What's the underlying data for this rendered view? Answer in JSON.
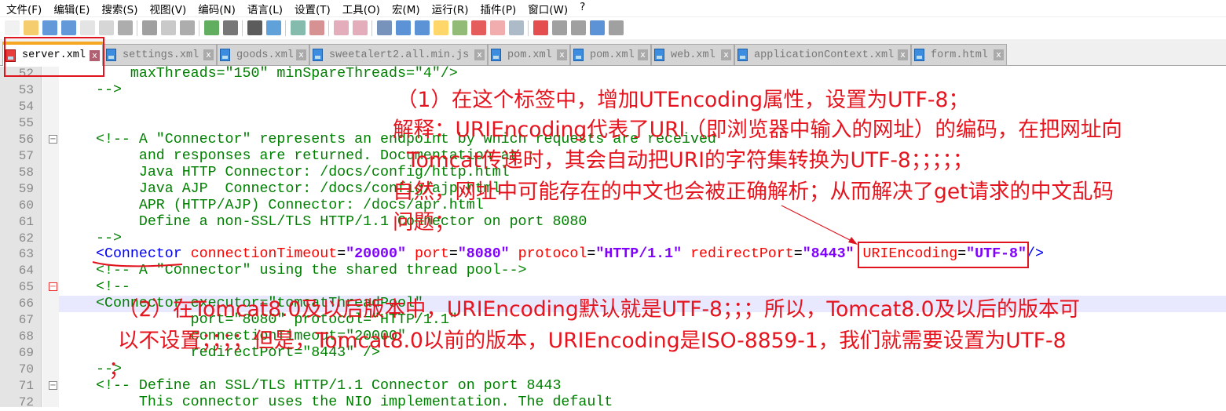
{
  "menu": [
    "文件(F)",
    "编辑(E)",
    "搜索(S)",
    "视图(V)",
    "编码(N)",
    "语言(L)",
    "设置(T)",
    "工具(O)",
    "宏(M)",
    "运行(R)",
    "插件(P)",
    "窗口(W)",
    "?"
  ],
  "tabs": [
    {
      "label": "server.xml",
      "active": true
    },
    {
      "label": "settings.xml"
    },
    {
      "label": "goods.xml"
    },
    {
      "label": "sweetalert2.all.min.js"
    },
    {
      "label": "pom.xml"
    },
    {
      "label": "pom.xml"
    },
    {
      "label": "web.xml"
    },
    {
      "label": "applicationContext.xml"
    },
    {
      "label": "form.html"
    }
  ],
  "close_glyph": "x",
  "lines": [
    {
      "n": "52",
      "fold": "",
      "html": "    maxThreads=\"150\" minSpareThreads=\"4\"/>"
    },
    {
      "n": "53",
      "fold": "",
      "html": "-->"
    },
    {
      "n": "54",
      "fold": "",
      "html": ""
    },
    {
      "n": "55",
      "fold": "",
      "html": ""
    },
    {
      "n": "56",
      "fold": "box",
      "html": "<!-- A \"Connector\" represents an endpoint by which requests are received"
    },
    {
      "n": "57",
      "fold": "",
      "html": "     and responses are returned. Documentation at :"
    },
    {
      "n": "58",
      "fold": "",
      "html": "     Java HTTP Connector: /docs/config/http.html"
    },
    {
      "n": "59",
      "fold": "",
      "html": "     Java AJP  Connector: /docs/config/ajp.html"
    },
    {
      "n": "60",
      "fold": "",
      "html": "     APR (HTTP/AJP) Connector: /docs/apr.html"
    },
    {
      "n": "61",
      "fold": "",
      "html": "     Define a non-SSL/TLS HTTP/1.1 Connector on port 8080"
    },
    {
      "n": "62",
      "fold": "",
      "html": "-->"
    },
    {
      "n": "63",
      "fold": "",
      "tokens": [
        [
          "tg",
          "<Connector "
        ],
        [
          "at",
          "connectionTimeout"
        ],
        [
          "pl",
          "="
        ],
        [
          "vl",
          "\"20000\""
        ],
        [
          "at",
          " port"
        ],
        [
          "pl",
          "="
        ],
        [
          "vl",
          "\"8080\""
        ],
        [
          "at",
          " protocol"
        ],
        [
          "pl",
          "="
        ],
        [
          "vl",
          "\"HTTP/1.1\""
        ],
        [
          "at",
          " redirectPort"
        ],
        [
          "pl",
          "="
        ],
        [
          "vl",
          "\"8443\""
        ],
        [
          "at",
          " URIEncoding"
        ],
        [
          "pl",
          "="
        ],
        [
          "vl",
          "\"UTF-8\""
        ],
        [
          "tg",
          "/>"
        ]
      ]
    },
    {
      "n": "64",
      "fold": "",
      "html": "<!-- A \"Connector\" using the shared thread pool-->"
    },
    {
      "n": "65",
      "fold": "red",
      "html": "<!--"
    },
    {
      "n": "66",
      "fold": "",
      "html": "<Connector executor=\"tomcatThreadPool\"",
      "cur": true
    },
    {
      "n": "67",
      "fold": "",
      "html": "           port=\"8080\" protocol=\"HTTP/1.1\""
    },
    {
      "n": "68",
      "fold": "",
      "html": "           connectionTimeout=\"20000\""
    },
    {
      "n": "69",
      "fold": "",
      "html": "           redirectPort=\"8443\" />"
    },
    {
      "n": "70",
      "fold": "",
      "html": "-->"
    },
    {
      "n": "71",
      "fold": "box",
      "html": "<!-- Define an SSL/TLS HTTP/1.1 Connector on port 8443"
    },
    {
      "n": "72",
      "fold": "",
      "html": "     This connector uses the NIO implementation. The default"
    }
  ],
  "annotations": {
    "a1": "（1）在这个标签中，增加UTEncoding属性，设置为UTF-8；",
    "a2": "解释：URIEncoding代表了URI（即浏览器中输入的网址）的编码，在把网址向",
    "a3": "Tomcat传递时，其会自动把URI的字符集转换为UTF-8；；；；；",
    "a4": "自然，网址中可能存在的中文也会被正确解析；从而解决了get请求的中文乱码",
    "a5": "问题；",
    "b1": "（2）在Tomcat8.0及以后版本中，URIEncoding默认就是UTF-8；；；所以，Tomcat8.0及以后的版本可",
    "b2": "以不设置；；；；但是，Tomcat8.0以前的版本，URIEncoding是ISO-8859-1，我们就需要设置为UTF-8",
    "b3": "；"
  },
  "colors": {
    "annotation": "#e6141e",
    "tag": "#0000ff",
    "attr": "#ff0000",
    "value": "#8000ff",
    "comment": "#008000"
  }
}
